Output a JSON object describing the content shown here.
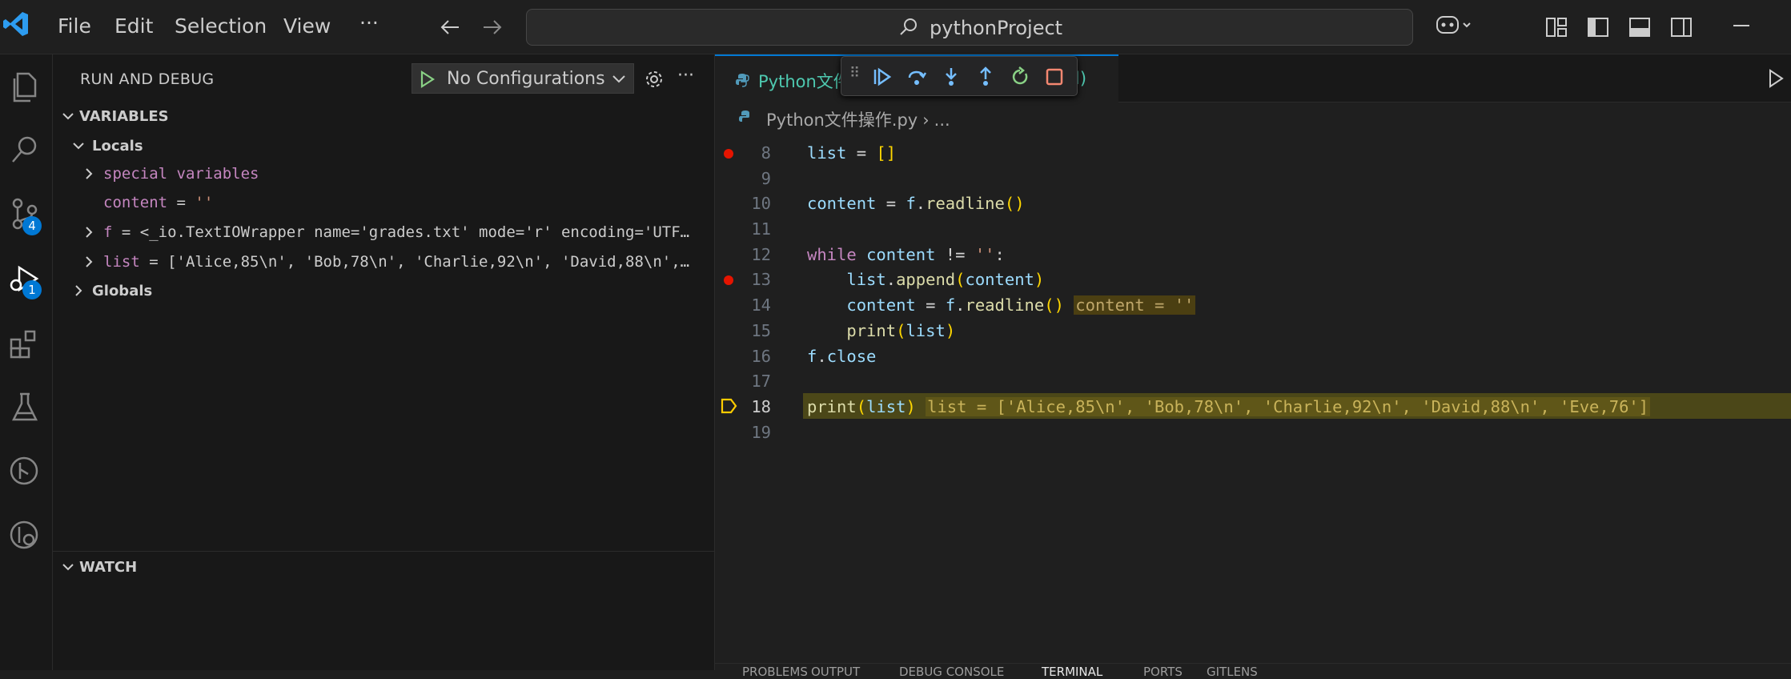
{
  "titlebar": {
    "menu": [
      "File",
      "Edit",
      "Selection",
      "View",
      "···"
    ],
    "search_text": "pythonProject"
  },
  "activity": {
    "scm_badge": "4",
    "debug_badge": "1"
  },
  "sidebar": {
    "title": "RUN AND DEBUG",
    "config_label": "No Configurations",
    "variables_header": "VARIABLES",
    "locals_header": "Locals",
    "special_vars": "special variables",
    "content_name": "content",
    "content_value": "''",
    "f_name": "f",
    "f_value": "<_io.TextIOWrapper name='grades.txt' mode='r' encoding='UTF…",
    "list_name": "list",
    "list_value": "['Alice,85\\n', 'Bob,78\\n', 'Charlie,92\\n', 'David,88\\n',…",
    "globals_header": "Globals",
    "watch_header": "WATCH"
  },
  "editor": {
    "tab_label": "Python文件",
    "tab_suffix": "l)",
    "breadcrumb_file": "Python文件操作.py",
    "breadcrumb_rest": "...",
    "lines": [
      {
        "num": "8"
      },
      {
        "num": "9"
      },
      {
        "num": "10"
      },
      {
        "num": "11"
      },
      {
        "num": "12"
      },
      {
        "num": "13"
      },
      {
        "num": "14"
      },
      {
        "num": "15"
      },
      {
        "num": "16"
      },
      {
        "num": "17"
      },
      {
        "num": "18"
      },
      {
        "num": "19"
      }
    ],
    "inline_content": "content = ''",
    "inline_list": "list = ['Alice,85\\n', 'Bob,78\\n', 'Charlie,92\\n', 'David,88\\n', 'Eve,76']"
  },
  "panel": {
    "tabs": [
      "PROBLEMS",
      "OUTPUT",
      "DEBUG CONSOLE",
      "TERMINAL",
      "PORTS",
      "GITLENS"
    ]
  },
  "colors": {
    "accent": "#0078d4",
    "breakpoint": "#e51400",
    "current_line": "#4b4718"
  }
}
